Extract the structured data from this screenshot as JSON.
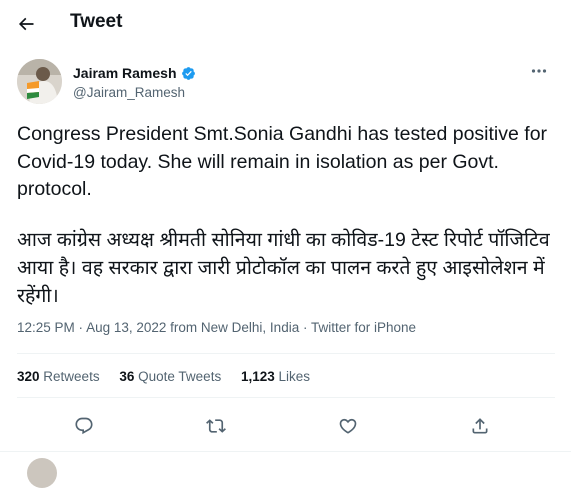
{
  "header": {
    "title": "Tweet",
    "back_icon": "arrow-left-icon"
  },
  "author": {
    "name": "Jairam Ramesh",
    "handle": "@Jairam_Ramesh",
    "verified": true,
    "verified_color": "#1d9bf0"
  },
  "tweet": {
    "text_en": "Congress President Smt.Sonia Gandhi has tested positive for Covid-19 today. She will remain in isolation as per Govt. protocol.",
    "text_hi": "आज कांग्रेस अध्यक्ष श्रीमती सोनिया गांधी का कोविड-19 टेस्ट रिपोर्ट पॉजिटिव आया है। वह सरकार द्वारा जारी प्रोटोकॉल का पालन करते हुए आइसोलेशन में रहेंगी।"
  },
  "meta": {
    "time": "12:25 PM",
    "sep1": " · ",
    "date": "Aug 13, 2022",
    "from": " from ",
    "location": "New Delhi, India",
    "sep2": " · ",
    "source": "Twitter for iPhone"
  },
  "stats": {
    "retweets_count": "320",
    "retweets_label": "Retweets",
    "quotes_count": "36",
    "quotes_label": "Quote Tweets",
    "likes_count": "1,123",
    "likes_label": "Likes"
  },
  "actions": [
    "reply-icon",
    "retweet-icon",
    "like-icon",
    "share-icon"
  ],
  "colors": {
    "text": "#0f1419",
    "secondary": "#536471",
    "accent": "#1d9bf0",
    "divider": "#eff3f4"
  }
}
